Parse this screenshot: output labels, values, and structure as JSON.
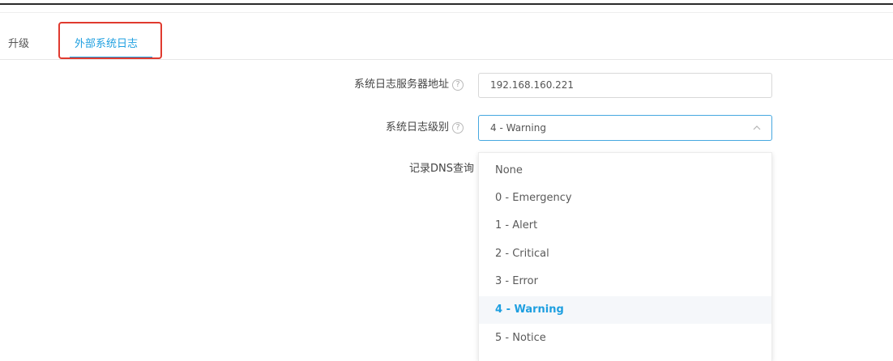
{
  "tabs": [
    {
      "label": "升级",
      "active": false
    },
    {
      "label": "外部系统日志",
      "active": true
    }
  ],
  "form": {
    "server_label": "系统日志服务器地址",
    "server_value": "192.168.160.221",
    "level_label": "系统日志级别",
    "level_value": "4 - Warning",
    "dns_label": "记录DNS查询"
  },
  "dropdown": {
    "options": [
      "None",
      "0 - Emergency",
      "1 - Alert",
      "2 - Critical",
      "3 - Error",
      "4 - Warning",
      "5 - Notice"
    ],
    "selected_index": 5
  },
  "icons": {
    "help": "help-circle-icon",
    "chevron": "chevron-up-icon"
  },
  "colors": {
    "accent": "#1e9fe0",
    "highlight_box": "#e03a2f",
    "select_border": "#46a8e0",
    "selected_bg": "#f5f7fa"
  }
}
